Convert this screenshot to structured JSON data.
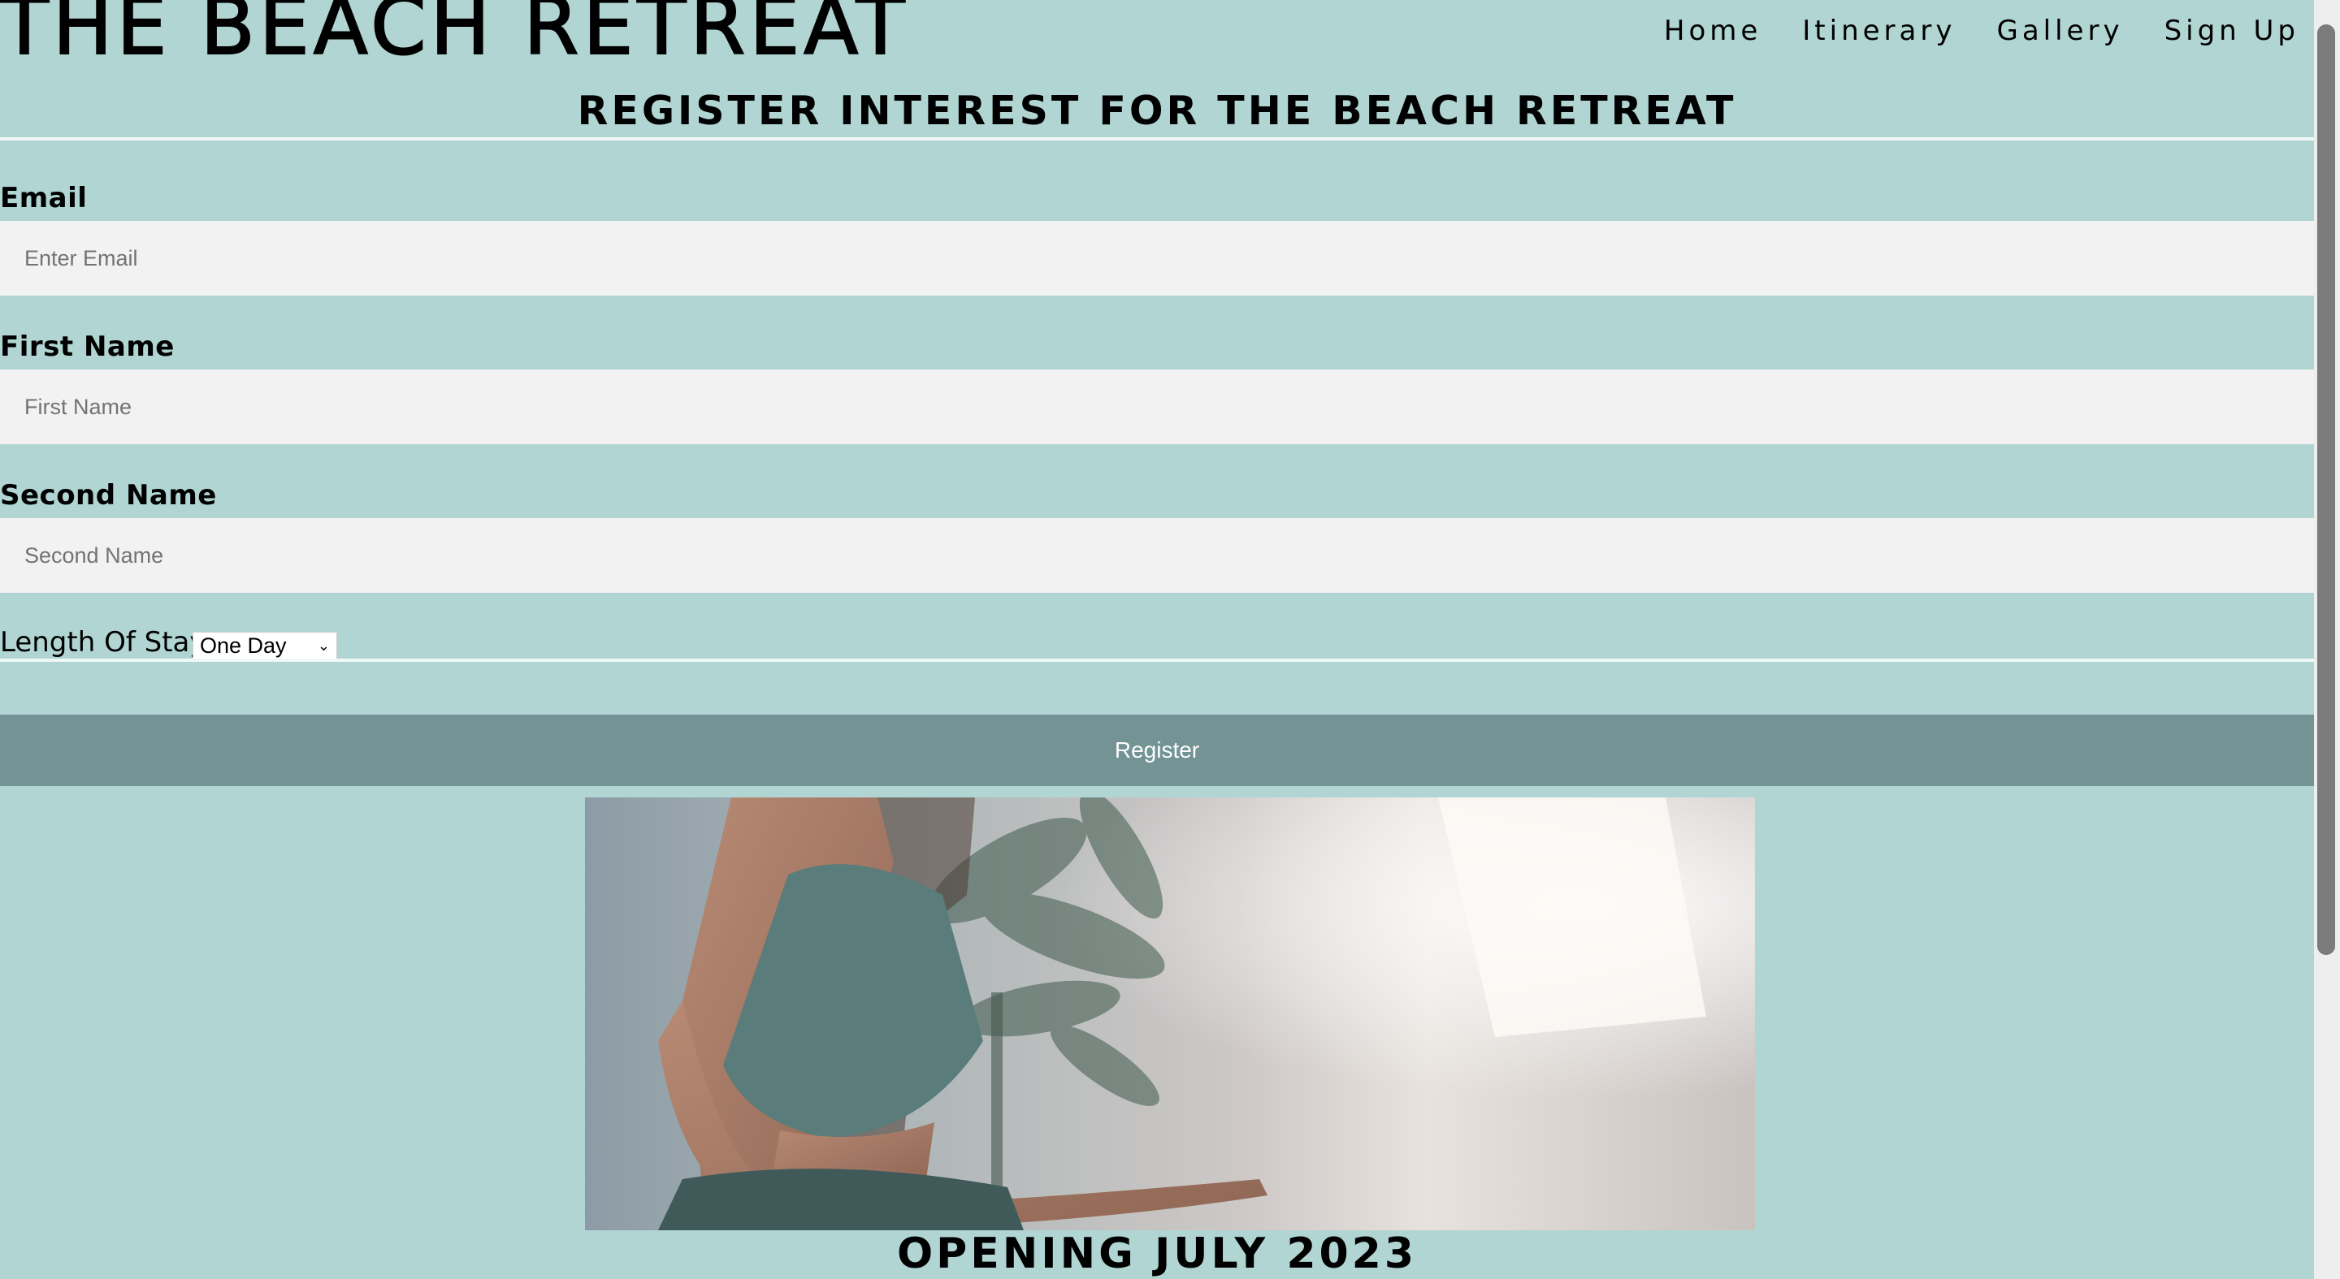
{
  "site": {
    "title": "THE BEACH RETREAT"
  },
  "nav": {
    "items": [
      "Home",
      "Itinerary",
      "Gallery",
      "Sign Up"
    ]
  },
  "form": {
    "heading": "REGISTER INTEREST FOR THE BEACH RETREAT",
    "email": {
      "label": "Email",
      "placeholder": "Enter Email",
      "value": ""
    },
    "first_name": {
      "label": "First Name",
      "placeholder": "First Name",
      "value": ""
    },
    "second_name": {
      "label": "Second Name",
      "placeholder": "Second Name",
      "value": ""
    },
    "length_of_stay": {
      "label": "Length Of Stay",
      "selected": "One Day"
    },
    "register_label": "Register"
  },
  "hero": {
    "alt": "Woman in a teal top meditating"
  },
  "footer": {
    "opening": "OPENING JULY 2023"
  },
  "colors": {
    "background": "#b0d5d3",
    "input_background": "#f2f2f2",
    "button": "#739395",
    "button_text": "#ffffff"
  }
}
